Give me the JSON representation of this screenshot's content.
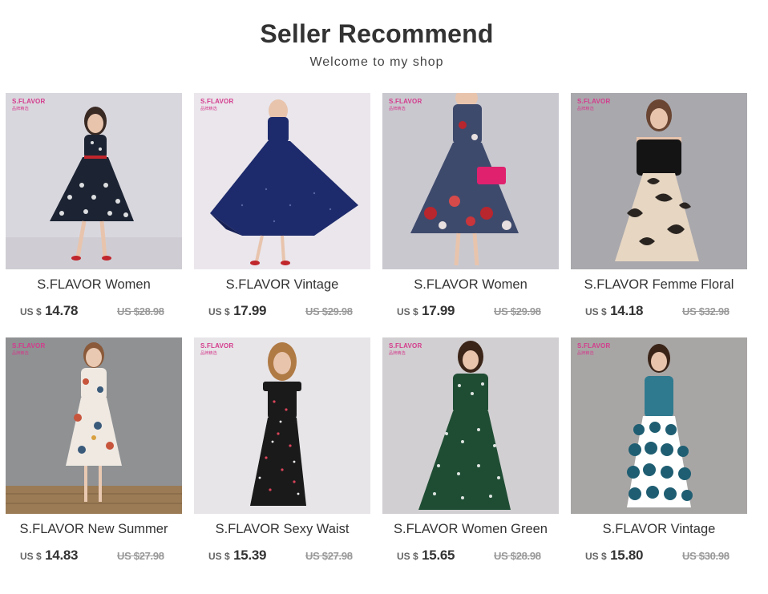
{
  "header": {
    "title": "Seller Recommend",
    "subtitle": "Welcome to my shop"
  },
  "brand_mark": "S.FLAVOR",
  "colors": {
    "brand_pink": "#d43b8c",
    "text": "#333333",
    "muted": "#999999"
  },
  "products": [
    {
      "title": "S.FLAVOR Women",
      "currency": "US $",
      "price": "14.78",
      "original": "US $28.98",
      "image": "woman-polka-dot-dress-photo"
    },
    {
      "title": "S.FLAVOR Vintage",
      "currency": "US $",
      "price": "17.99",
      "original": "US $29.98",
      "image": "navy-swing-dress-photo"
    },
    {
      "title": "S.FLAVOR Women",
      "currency": "US $",
      "price": "17.99",
      "original": "US $29.98",
      "image": "floral-dress-photo"
    },
    {
      "title": "S.FLAVOR Femme Floral",
      "currency": "US $",
      "price": "14.18",
      "original": "US $32.98",
      "image": "off-shoulder-floral-dress-photo"
    },
    {
      "title": "S.FLAVOR New Summer",
      "currency": "US $",
      "price": "14.83",
      "original": "US $27.98",
      "image": "printed-summer-dress-photo"
    },
    {
      "title": "S.FLAVOR Sexy Waist",
      "currency": "US $",
      "price": "15.39",
      "original": "US $27.98",
      "image": "black-ruffle-dress-photo"
    },
    {
      "title": "S.FLAVOR Women Green",
      "currency": "US $",
      "price": "15.65",
      "original": "US $28.98",
      "image": "green-polka-dot-dress-photo"
    },
    {
      "title": "S.FLAVOR Vintage",
      "currency": "US $",
      "price": "15.80",
      "original": "US $30.98",
      "image": "teal-dot-skirt-dress-photo"
    }
  ]
}
